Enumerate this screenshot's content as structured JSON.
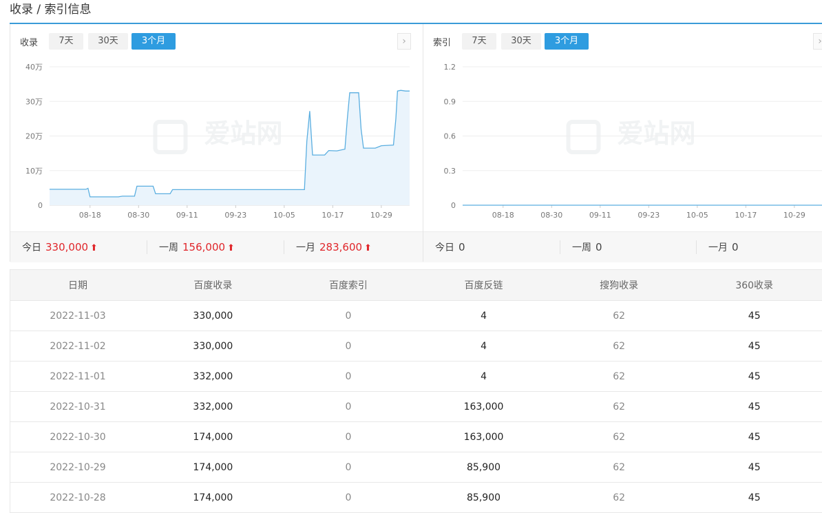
{
  "page": {
    "title": "收录 / 索引信息"
  },
  "left_panel": {
    "label": "收录",
    "tabs": [
      {
        "label": "7天",
        "active": false
      },
      {
        "label": "30天",
        "active": false
      },
      {
        "label": "3个月",
        "active": true
      }
    ],
    "stats": {
      "today": {
        "label": "今日",
        "value": "330,000"
      },
      "week": {
        "label": "一周",
        "value": "156,000"
      },
      "month": {
        "label": "一月",
        "value": "283,600"
      }
    }
  },
  "right_panel": {
    "label": "索引",
    "tabs": [
      {
        "label": "7天",
        "active": false
      },
      {
        "label": "30天",
        "active": false
      },
      {
        "label": "3个月",
        "active": true
      }
    ],
    "stats": {
      "today": {
        "label": "今日",
        "value": "0"
      },
      "week": {
        "label": "一周",
        "value": "0"
      },
      "month": {
        "label": "一月",
        "value": "0"
      }
    }
  },
  "icons": {
    "next": "chevron-right-icon",
    "up_arrow": "arrow-up-icon"
  },
  "colors": {
    "accent": "#2e9ce0",
    "line": "#5aaee0",
    "area": "#eaf4fc",
    "up": "#e0262b"
  },
  "chart_data": [
    {
      "type": "area",
      "ylim": [
        0,
        400000
      ],
      "y_tick_labels": [
        "0",
        "10万",
        "20万",
        "30万",
        "40万"
      ],
      "x_tick_labels": [
        "08-18",
        "08-30",
        "09-11",
        "09-23",
        "10-05",
        "10-17",
        "10-29"
      ],
      "x_tick_days": [
        10,
        22,
        34,
        46,
        58,
        70,
        82
      ],
      "x_range_days": [
        0,
        89
      ],
      "watermark": "爱站网",
      "points": [
        [
          0,
          46000
        ],
        [
          9,
          46000
        ],
        [
          9.5,
          49000
        ],
        [
          10,
          24000
        ],
        [
          17,
          24000
        ],
        [
          18,
          26000
        ],
        [
          21,
          26000
        ],
        [
          21.6,
          55000
        ],
        [
          25.6,
          55000
        ],
        [
          26.2,
          33000
        ],
        [
          29.8,
          33000
        ],
        [
          30.4,
          45000
        ],
        [
          63,
          45000
        ],
        [
          63.6,
          185000
        ],
        [
          64.3,
          272000
        ],
        [
          65,
          145000
        ],
        [
          68,
          145000
        ],
        [
          69,
          158000
        ],
        [
          71,
          157000
        ],
        [
          73,
          162000
        ],
        [
          73.6,
          250000
        ],
        [
          74.2,
          325000
        ],
        [
          76.4,
          325000
        ],
        [
          77,
          220000
        ],
        [
          77.6,
          165000
        ],
        [
          80.5,
          165000
        ],
        [
          82,
          172000
        ],
        [
          85,
          174000
        ],
        [
          85.6,
          250000
        ],
        [
          86,
          330000
        ],
        [
          86.8,
          332000
        ],
        [
          88,
          330000
        ],
        [
          89,
          330000
        ]
      ]
    },
    {
      "type": "area",
      "ylim": [
        0,
        1.2
      ],
      "y_tick_labels": [
        "0",
        "0.3",
        "0.6",
        "0.9",
        "1.2"
      ],
      "x_tick_labels": [
        "08-18",
        "08-30",
        "09-11",
        "09-23",
        "10-05",
        "10-17",
        "10-29"
      ],
      "x_tick_days": [
        10,
        22,
        34,
        46,
        58,
        70,
        82
      ],
      "x_range_days": [
        0,
        89
      ],
      "watermark": "爱站网",
      "points": [
        [
          0,
          0
        ],
        [
          89,
          0
        ]
      ]
    }
  ],
  "table": {
    "headers": [
      "日期",
      "百度收录",
      "百度索引",
      "百度反链",
      "搜狗收录",
      "360收录"
    ],
    "rows": [
      [
        "2022-11-03",
        "330,000",
        "0",
        "4",
        "62",
        "45"
      ],
      [
        "2022-11-02",
        "330,000",
        "0",
        "4",
        "62",
        "45"
      ],
      [
        "2022-11-01",
        "332,000",
        "0",
        "4",
        "62",
        "45"
      ],
      [
        "2022-10-31",
        "332,000",
        "0",
        "163,000",
        "62",
        "45"
      ],
      [
        "2022-10-30",
        "174,000",
        "0",
        "163,000",
        "62",
        "45"
      ],
      [
        "2022-10-29",
        "174,000",
        "0",
        "85,900",
        "62",
        "45"
      ],
      [
        "2022-10-28",
        "174,000",
        "0",
        "85,900",
        "62",
        "45"
      ]
    ]
  }
}
